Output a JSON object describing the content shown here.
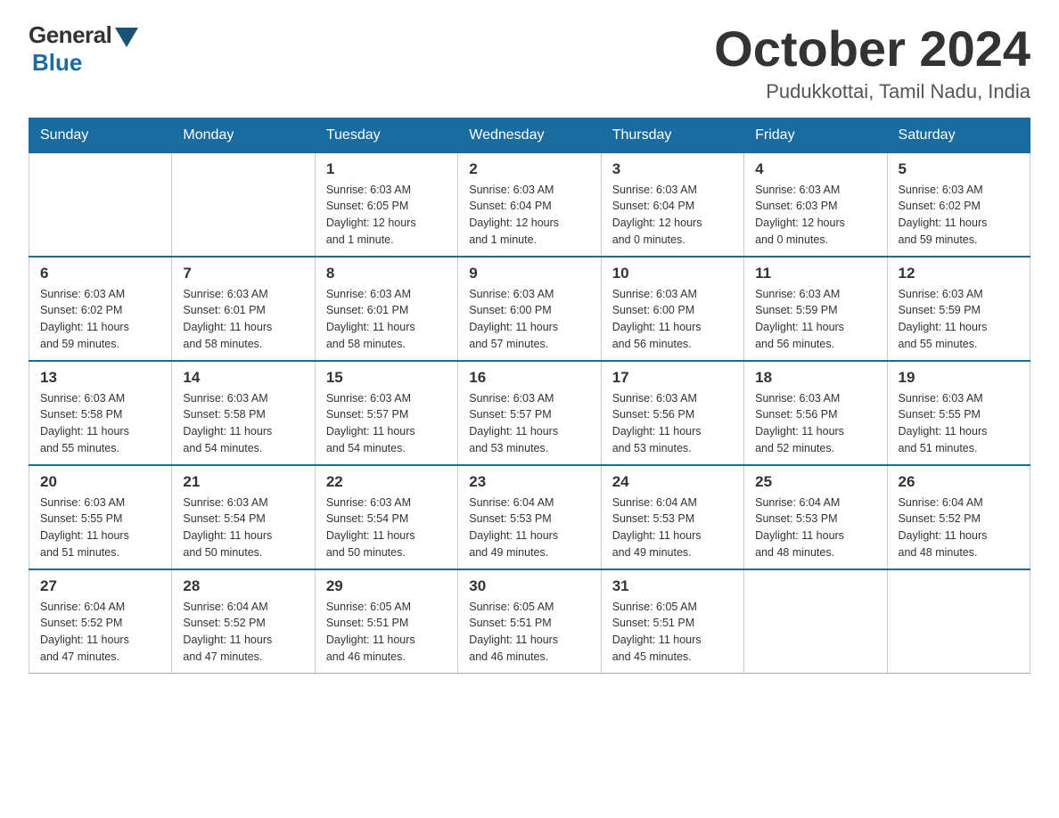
{
  "header": {
    "logo": {
      "general": "General",
      "blue": "Blue"
    },
    "title": "October 2024",
    "subtitle": "Pudukkottai, Tamil Nadu, India"
  },
  "calendar": {
    "days_of_week": [
      "Sunday",
      "Monday",
      "Tuesday",
      "Wednesday",
      "Thursday",
      "Friday",
      "Saturday"
    ],
    "weeks": [
      [
        {
          "day": "",
          "info": ""
        },
        {
          "day": "",
          "info": ""
        },
        {
          "day": "1",
          "info": "Sunrise: 6:03 AM\nSunset: 6:05 PM\nDaylight: 12 hours\nand 1 minute."
        },
        {
          "day": "2",
          "info": "Sunrise: 6:03 AM\nSunset: 6:04 PM\nDaylight: 12 hours\nand 1 minute."
        },
        {
          "day": "3",
          "info": "Sunrise: 6:03 AM\nSunset: 6:04 PM\nDaylight: 12 hours\nand 0 minutes."
        },
        {
          "day": "4",
          "info": "Sunrise: 6:03 AM\nSunset: 6:03 PM\nDaylight: 12 hours\nand 0 minutes."
        },
        {
          "day": "5",
          "info": "Sunrise: 6:03 AM\nSunset: 6:02 PM\nDaylight: 11 hours\nand 59 minutes."
        }
      ],
      [
        {
          "day": "6",
          "info": "Sunrise: 6:03 AM\nSunset: 6:02 PM\nDaylight: 11 hours\nand 59 minutes."
        },
        {
          "day": "7",
          "info": "Sunrise: 6:03 AM\nSunset: 6:01 PM\nDaylight: 11 hours\nand 58 minutes."
        },
        {
          "day": "8",
          "info": "Sunrise: 6:03 AM\nSunset: 6:01 PM\nDaylight: 11 hours\nand 58 minutes."
        },
        {
          "day": "9",
          "info": "Sunrise: 6:03 AM\nSunset: 6:00 PM\nDaylight: 11 hours\nand 57 minutes."
        },
        {
          "day": "10",
          "info": "Sunrise: 6:03 AM\nSunset: 6:00 PM\nDaylight: 11 hours\nand 56 minutes."
        },
        {
          "day": "11",
          "info": "Sunrise: 6:03 AM\nSunset: 5:59 PM\nDaylight: 11 hours\nand 56 minutes."
        },
        {
          "day": "12",
          "info": "Sunrise: 6:03 AM\nSunset: 5:59 PM\nDaylight: 11 hours\nand 55 minutes."
        }
      ],
      [
        {
          "day": "13",
          "info": "Sunrise: 6:03 AM\nSunset: 5:58 PM\nDaylight: 11 hours\nand 55 minutes."
        },
        {
          "day": "14",
          "info": "Sunrise: 6:03 AM\nSunset: 5:58 PM\nDaylight: 11 hours\nand 54 minutes."
        },
        {
          "day": "15",
          "info": "Sunrise: 6:03 AM\nSunset: 5:57 PM\nDaylight: 11 hours\nand 54 minutes."
        },
        {
          "day": "16",
          "info": "Sunrise: 6:03 AM\nSunset: 5:57 PM\nDaylight: 11 hours\nand 53 minutes."
        },
        {
          "day": "17",
          "info": "Sunrise: 6:03 AM\nSunset: 5:56 PM\nDaylight: 11 hours\nand 53 minutes."
        },
        {
          "day": "18",
          "info": "Sunrise: 6:03 AM\nSunset: 5:56 PM\nDaylight: 11 hours\nand 52 minutes."
        },
        {
          "day": "19",
          "info": "Sunrise: 6:03 AM\nSunset: 5:55 PM\nDaylight: 11 hours\nand 51 minutes."
        }
      ],
      [
        {
          "day": "20",
          "info": "Sunrise: 6:03 AM\nSunset: 5:55 PM\nDaylight: 11 hours\nand 51 minutes."
        },
        {
          "day": "21",
          "info": "Sunrise: 6:03 AM\nSunset: 5:54 PM\nDaylight: 11 hours\nand 50 minutes."
        },
        {
          "day": "22",
          "info": "Sunrise: 6:03 AM\nSunset: 5:54 PM\nDaylight: 11 hours\nand 50 minutes."
        },
        {
          "day": "23",
          "info": "Sunrise: 6:04 AM\nSunset: 5:53 PM\nDaylight: 11 hours\nand 49 minutes."
        },
        {
          "day": "24",
          "info": "Sunrise: 6:04 AM\nSunset: 5:53 PM\nDaylight: 11 hours\nand 49 minutes."
        },
        {
          "day": "25",
          "info": "Sunrise: 6:04 AM\nSunset: 5:53 PM\nDaylight: 11 hours\nand 48 minutes."
        },
        {
          "day": "26",
          "info": "Sunrise: 6:04 AM\nSunset: 5:52 PM\nDaylight: 11 hours\nand 48 minutes."
        }
      ],
      [
        {
          "day": "27",
          "info": "Sunrise: 6:04 AM\nSunset: 5:52 PM\nDaylight: 11 hours\nand 47 minutes."
        },
        {
          "day": "28",
          "info": "Sunrise: 6:04 AM\nSunset: 5:52 PM\nDaylight: 11 hours\nand 47 minutes."
        },
        {
          "day": "29",
          "info": "Sunrise: 6:05 AM\nSunset: 5:51 PM\nDaylight: 11 hours\nand 46 minutes."
        },
        {
          "day": "30",
          "info": "Sunrise: 6:05 AM\nSunset: 5:51 PM\nDaylight: 11 hours\nand 46 minutes."
        },
        {
          "day": "31",
          "info": "Sunrise: 6:05 AM\nSunset: 5:51 PM\nDaylight: 11 hours\nand 45 minutes."
        },
        {
          "day": "",
          "info": ""
        },
        {
          "day": "",
          "info": ""
        }
      ]
    ]
  }
}
